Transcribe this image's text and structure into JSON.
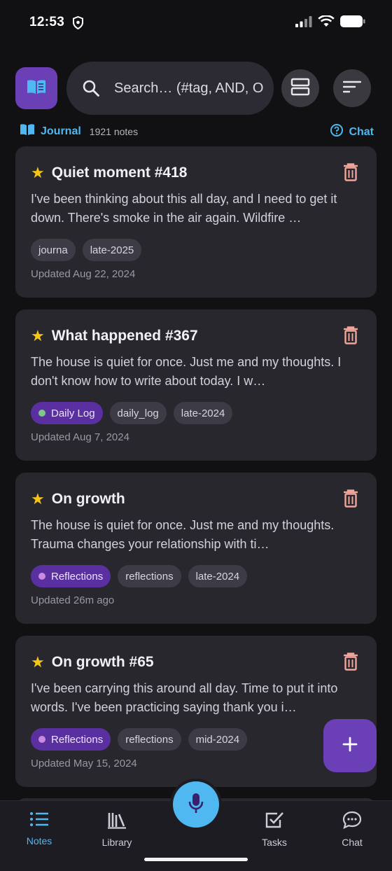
{
  "status_bar": {
    "time": "12:53"
  },
  "header": {
    "search_placeholder": "Search… (#tag, AND, O",
    "journal_name": "Journal",
    "note_count": "1921 notes",
    "chat_label": "Chat"
  },
  "notes": [
    {
      "title": "Quiet moment #418",
      "body": "I've been thinking about this all day, and I need to get it down. There's smoke in the air again. Wildfire …",
      "tags": [
        {
          "label": "journa",
          "special": false
        },
        {
          "label": "late-2025",
          "special": false
        }
      ],
      "updated": "Updated Aug 22, 2024"
    },
    {
      "title": "What happened #367",
      "body": "The house is quiet for once. Just me and my thoughts. I don't know how to write about today. I w…",
      "tags": [
        {
          "label": "Daily Log",
          "special": true,
          "dot_color": "#7cc98a"
        },
        {
          "label": "daily_log",
          "special": false
        },
        {
          "label": "late-2024",
          "special": false
        }
      ],
      "updated": "Updated Aug 7, 2024"
    },
    {
      "title": "On growth",
      "body": "The house is quiet for once. Just me and my thoughts. Trauma changes your relationship with ti…",
      "tags": [
        {
          "label": "Reflections",
          "special": true,
          "dot_color": "#c98ae0"
        },
        {
          "label": "reflections",
          "special": false
        },
        {
          "label": "late-2024",
          "special": false
        }
      ],
      "updated": "Updated 26m ago"
    },
    {
      "title": "On growth #65",
      "body": "I've been carrying this around all day. Time to put it into words. I've been practicing saying thank you i…",
      "tags": [
        {
          "label": "Reflections",
          "special": true,
          "dot_color": "#c98ae0"
        },
        {
          "label": "reflections",
          "special": false
        },
        {
          "label": "mid-2024",
          "special": false
        }
      ],
      "updated": "Updated May 15, 2024"
    }
  ],
  "bottom_nav": {
    "items": [
      {
        "label": "Notes",
        "icon": "list-icon",
        "active": true
      },
      {
        "label": "Library",
        "icon": "library-icon",
        "active": false
      },
      {
        "label": "Tasks",
        "icon": "checkbox-icon",
        "active": false
      },
      {
        "label": "Chat",
        "icon": "chat-bubble-icon",
        "active": false
      }
    ]
  },
  "colors": {
    "accent_blue": "#4fb8f0",
    "accent_purple": "#6b3fb5",
    "star": "#f5c518",
    "trash": "#f0a49a"
  }
}
